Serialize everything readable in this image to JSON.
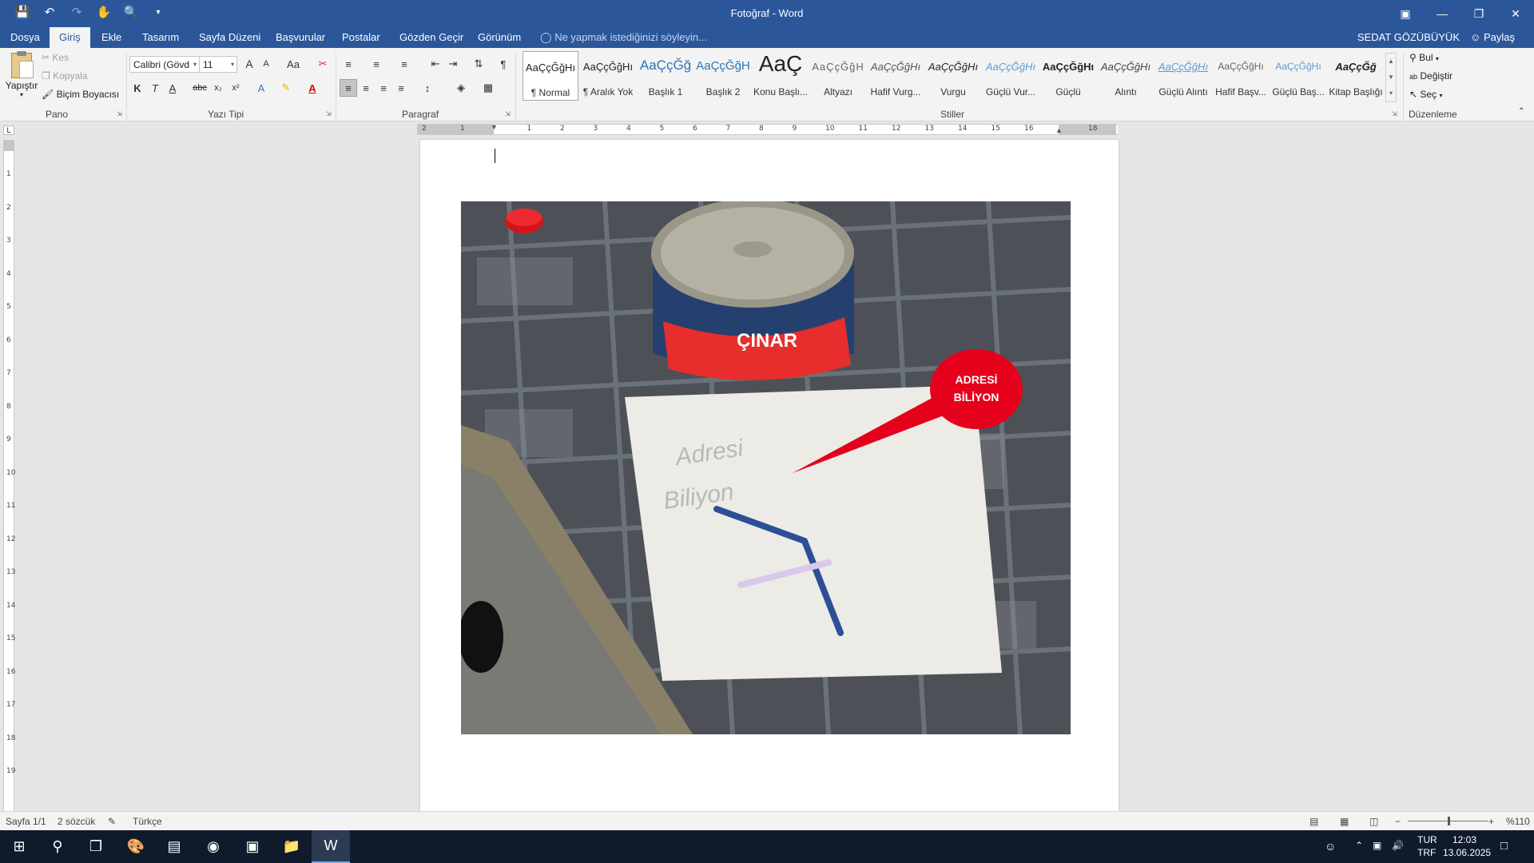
{
  "app": {
    "title": "Fotoğraf - Word",
    "user_name": "SEDAT GÖZÜBÜYÜK",
    "share_label": "Paylaş",
    "tell_me_placeholder": "Ne yapmak istediğinizi söyleyin..."
  },
  "tabs": [
    {
      "label": "Dosya"
    },
    {
      "label": "Giriş"
    },
    {
      "label": "Ekle"
    },
    {
      "label": "Tasarım"
    },
    {
      "label": "Sayfa Düzeni"
    },
    {
      "label": "Başvurular"
    },
    {
      "label": "Postalar"
    },
    {
      "label": "Gözden Geçir"
    },
    {
      "label": "Görünüm"
    }
  ],
  "ribbon": {
    "clipboard": {
      "group_label": "Pano",
      "paste_label": "Yapıştır",
      "cut_label": "Kes",
      "copy_label": "Kopyala",
      "format_painter_label": "Biçim Boyacısı"
    },
    "font": {
      "group_label": "Yazı Tipi",
      "font_name": "Calibri (Gövd",
      "font_size": "11",
      "bold": "K",
      "italic": "T",
      "underline": "A",
      "strike": "abc",
      "subscript": "x₂",
      "superscript": "x²",
      "change_case": "Aa",
      "grow": "A",
      "shrink": "A"
    },
    "paragraph": {
      "group_label": "Paragraf"
    },
    "styles": {
      "group_label": "Stiller",
      "items": [
        {
          "preview": "AaÇçĞğHı",
          "name": "¶ Normal"
        },
        {
          "preview": "AaÇçĞğHı",
          "name": "¶ Aralık Yok"
        },
        {
          "preview": "AaÇçĞğ",
          "name": "Başlık 1"
        },
        {
          "preview": "AaÇçĞğH",
          "name": "Başlık 2"
        },
        {
          "preview": "AaÇ",
          "name": "Konu Başlı..."
        },
        {
          "preview": "AaÇçĞğH",
          "name": "Altyazı"
        },
        {
          "preview": "AaÇçĞğHı",
          "name": "Hafif Vurg..."
        },
        {
          "preview": "AaÇçĞğHı",
          "name": "Vurgu"
        },
        {
          "preview": "AaÇçĞğHı",
          "name": "Güçlü Vur..."
        },
        {
          "preview": "AaÇçĞğHı",
          "name": "Güçlü"
        },
        {
          "preview": "AaÇçĞğHı",
          "name": "Alıntı"
        },
        {
          "preview": "AaÇçĞğHı",
          "name": "Güçlü Alıntı"
        },
        {
          "preview": "AaÇçĞğHı",
          "name": "Hafif Başv..."
        },
        {
          "preview": "AaÇçĞğHı",
          "name": "Güçlü Baş..."
        },
        {
          "preview": "AaÇçĞğ",
          "name": "Kitap Başlığı"
        }
      ]
    },
    "editing": {
      "group_label": "Düzenleme",
      "find_label": "Bul",
      "replace_label": "Değiştir",
      "select_label": "Seç"
    }
  },
  "ruler": {
    "h_numbers": [
      "2",
      "1",
      "1",
      "2",
      "3",
      "4",
      "5",
      "6",
      "7",
      "8",
      "9",
      "10",
      "11",
      "12",
      "13",
      "14",
      "15",
      "16",
      "18"
    ],
    "v_numbers": [
      "1",
      "2",
      "3",
      "4",
      "5",
      "6",
      "7",
      "8",
      "9",
      "10",
      "11",
      "12",
      "13",
      "14",
      "15",
      "16",
      "17",
      "18",
      "19"
    ]
  },
  "document": {
    "bubble_text_line1": "ADRESİ",
    "bubble_text_line2": "BİLİYON",
    "can_brand": "ÇINAR"
  },
  "status": {
    "page": "Sayfa 1/1",
    "words": "2 sözcük",
    "language": "Türkçe",
    "zoom": "%110",
    "zoom_value": 110
  },
  "taskbar": {
    "lang_top": "TUR",
    "lang_bottom": "TRF",
    "time": "12:03",
    "date": "13.06.2025"
  },
  "colors": {
    "title_bar": "#2b579a",
    "ribbon_bg": "#f3f3f3",
    "bubble_red": "#e5001b",
    "taskbar": "#0f1a2a"
  }
}
